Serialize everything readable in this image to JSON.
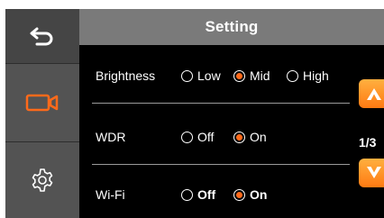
{
  "header": {
    "title": "Setting"
  },
  "sidebar": {
    "back_icon": "back-arrow-icon",
    "video_icon": "video-camera-icon",
    "settings_icon": "gear-icon"
  },
  "settings": {
    "rows": [
      {
        "label": "Brightness",
        "options": [
          "Low",
          "Mid",
          "High"
        ],
        "selected": "Mid"
      },
      {
        "label": "WDR",
        "options": [
          "Off",
          "On"
        ],
        "selected": "On"
      },
      {
        "label": "Wi-Fi",
        "options": [
          "Off",
          "On"
        ],
        "selected": "On"
      }
    ]
  },
  "pager": {
    "text": "1/3"
  },
  "colors": {
    "accent": "#ff6a1a",
    "rail": "#535353",
    "titlebar": "#7a7a7a",
    "background": "#000000"
  }
}
